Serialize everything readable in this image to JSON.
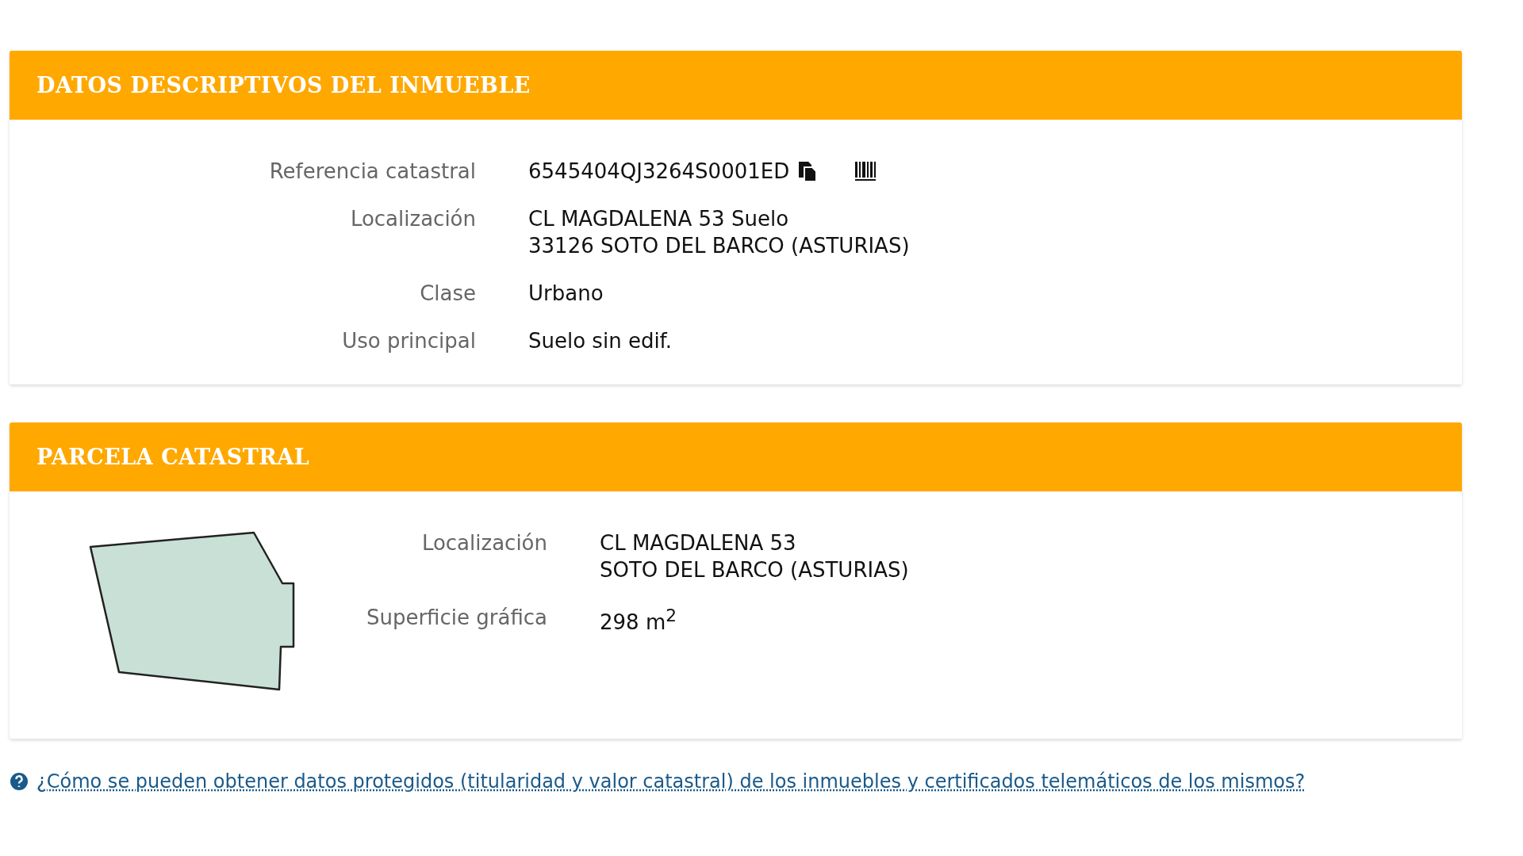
{
  "sections": [
    {
      "title": "DATOS DESCRIPTIVOS DEL INMUEBLE",
      "kind": "fields",
      "rows": [
        {
          "label": "Referencia catastral",
          "lines": [
            "6545404QJ3264S0001ED"
          ],
          "kind": "reference"
        },
        {
          "label": "Localización",
          "lines": [
            "CL MAGDALENA 53 Suelo",
            "33126 SOTO DEL BARCO (ASTURIAS)"
          ],
          "kind": "text"
        },
        {
          "label": "Clase",
          "lines": [
            "Urbano"
          ],
          "kind": "text"
        },
        {
          "label": "Uso principal",
          "lines": [
            "Suelo sin edif."
          ],
          "kind": "text"
        }
      ]
    },
    {
      "title": "PARCELA CATASTRAL",
      "kind": "parcel",
      "rows": [
        {
          "label": "Localización",
          "lines": [
            "CL MAGDALENA 53",
            "SOTO DEL BARCO (ASTURIAS)"
          ],
          "kind": "text"
        },
        {
          "label": "Superficie gráfica",
          "lines": [
            "298 m$^{2}$"
          ],
          "kind": "text"
        }
      ]
    }
  ],
  "help_link": "¿Cómo se pueden obtener datos protegidos (titularidad y valor catastral) de los inmuebles y certificados telemáticos de los mismos?"
}
